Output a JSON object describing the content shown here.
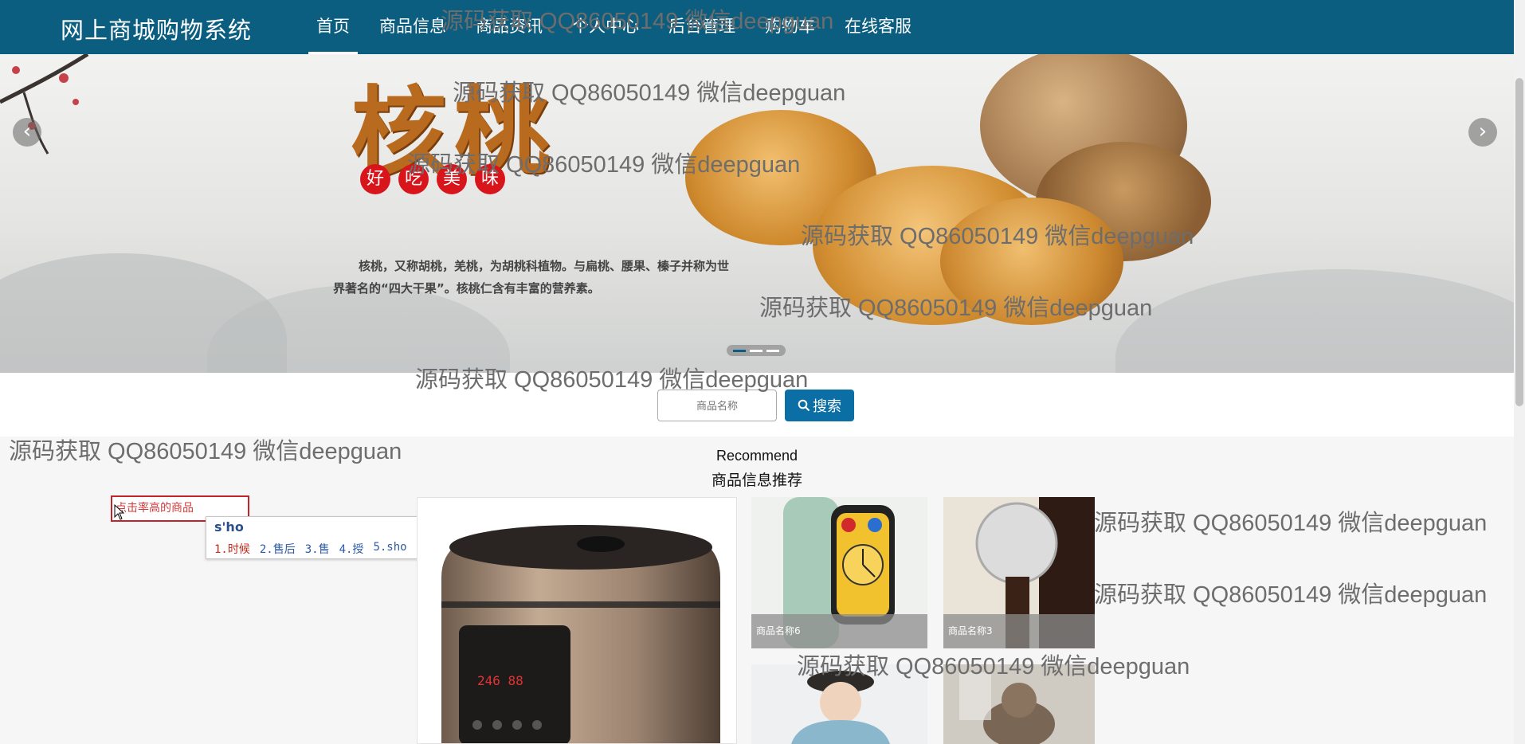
{
  "nav": {
    "brand": "网上商城购物系统",
    "items": [
      {
        "label": "首页",
        "active": true
      },
      {
        "label": "商品信息"
      },
      {
        "label": "商品资讯"
      },
      {
        "label": "个人中心"
      },
      {
        "label": "后台管理"
      },
      {
        "label": "购物车"
      },
      {
        "label": "在线客服"
      }
    ],
    "color": "#0b5e80"
  },
  "banner": {
    "title": "核桃",
    "badges": [
      "好",
      "吃",
      "美",
      "味"
    ],
    "description": "核桃，又称胡桃，羌桃，为胡桃科植物。与扁桃、腰果、榛子并称为世界著名的“四大干果”。核桃仁含有丰富的营养素。",
    "prev_icon": "chevron-left",
    "next_icon": "chevron-right",
    "slide_count": 3,
    "active_slide": 1
  },
  "search": {
    "placeholder": "商品名称",
    "button_label": "搜索",
    "button_icon": "search-icon"
  },
  "recommend": {
    "title_en": "Recommend",
    "title_cn": "商品信息推荐"
  },
  "sidebar": {
    "box_text": "点击率高的商品"
  },
  "ime": {
    "input": "s'ho",
    "candidates": [
      "1.时候",
      "2.售后",
      "3.售",
      "4.授",
      "5.sho"
    ],
    "nav_prev": "‹",
    "nav_next": "›",
    "nav_expand": "⌄"
  },
  "products": {
    "p6": "商品名称6",
    "p3": "商品名称3"
  },
  "watermark": "源码获取 QQ86050149 微信deepguan",
  "colors": {
    "accent": "#0b6ea4",
    "badge_red": "#d8151b",
    "box_red": "#c3232b"
  }
}
